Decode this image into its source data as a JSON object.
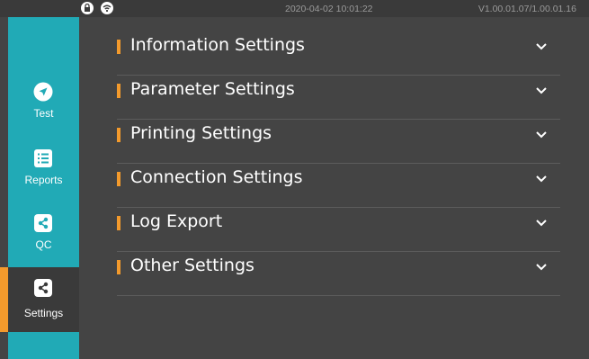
{
  "status_bar": {
    "datetime": "2020-04-02 10:01:22",
    "version": "V1.00.01.07/1.00.01.16",
    "icons": [
      "lock-icon",
      "wifi-icon"
    ]
  },
  "sidebar": {
    "items": [
      {
        "label": "Test",
        "icon": "navigation-arrow-icon",
        "active": false
      },
      {
        "label": "Reports",
        "icon": "list-icon",
        "active": false
      },
      {
        "label": "QC",
        "icon": "share-icon",
        "active": false
      },
      {
        "label": "Settings",
        "icon": "share-icon",
        "active": true
      }
    ]
  },
  "settings": {
    "sections": [
      {
        "label": "Information Settings"
      },
      {
        "label": "Parameter Settings"
      },
      {
        "label": "Printing Settings"
      },
      {
        "label": "Connection Settings"
      },
      {
        "label": "Log Export"
      },
      {
        "label": "Other Settings"
      }
    ]
  },
  "colors": {
    "accent": "#f39a2c",
    "sidebar": "#21aab6",
    "background": "#444444"
  }
}
